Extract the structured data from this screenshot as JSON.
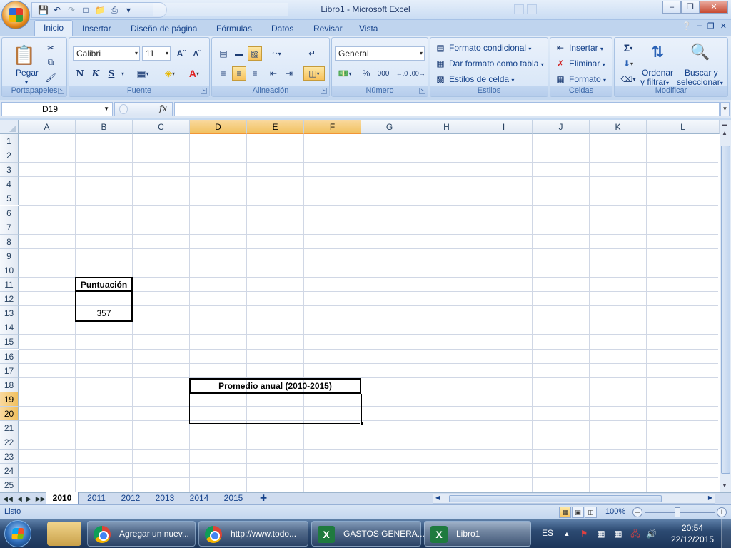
{
  "window": {
    "title": "Libro1 - Microsoft Excel"
  },
  "ribbon_tabs": [
    "Inicio",
    "Insertar",
    "Diseño de página",
    "Fórmulas",
    "Datos",
    "Revisar",
    "Vista"
  ],
  "ribbon": {
    "clipboard": {
      "paste": "Pegar",
      "label": "Portapapeles"
    },
    "font": {
      "name": "Calibri",
      "size": "11",
      "bold": "N",
      "italic": "K",
      "underline": "S",
      "label": "Fuente"
    },
    "alignment": {
      "label": "Alineación"
    },
    "number": {
      "format": "General",
      "percent": "%",
      "thousands": "000",
      "label": "Número"
    },
    "styles": {
      "conditional": "Formato condicional",
      "as_table": "Dar formato como tabla",
      "cell_styles": "Estilos de celda",
      "label": "Estilos"
    },
    "cells": {
      "insert": "Insertar",
      "delete": "Eliminar",
      "format": "Formato",
      "label": "Celdas"
    },
    "editing": {
      "sort_1": "Ordenar",
      "sort_2": "y filtrar",
      "find_1": "Buscar y",
      "find_2": "seleccionar",
      "label": "Modificar"
    }
  },
  "formula_bar": {
    "name_box": "D19",
    "fx": "fx",
    "formula": ""
  },
  "grid": {
    "columns": [
      "A",
      "B",
      "C",
      "D",
      "E",
      "F",
      "G",
      "H",
      "I",
      "J",
      "K",
      "L"
    ],
    "rows": [
      "1",
      "2",
      "3",
      "4",
      "5",
      "6",
      "7",
      "8",
      "9",
      "10",
      "11",
      "12",
      "13",
      "14",
      "15",
      "16",
      "17",
      "18",
      "19",
      "20",
      "21",
      "22",
      "23",
      "24",
      "25"
    ],
    "selected_columns": [
      "D",
      "E",
      "F"
    ],
    "selected_rows": [
      "19",
      "20"
    ],
    "cells": {
      "B11": "Puntuación",
      "B13": "357",
      "D18": "Promedio anual (2010-2015)"
    }
  },
  "sheets": [
    "2010",
    "2011",
    "2012",
    "2013",
    "2014",
    "2015"
  ],
  "active_sheet": "2010",
  "status": {
    "text": "Listo",
    "zoom": "100%"
  },
  "taskbar": {
    "items": [
      {
        "label": "Agregar un nuev..."
      },
      {
        "label": "http://www.todo..."
      },
      {
        "label": "GASTOS GENERA..."
      },
      {
        "label": "Libro1"
      }
    ],
    "lang": "ES",
    "time": "20:54",
    "date": "22/12/2015"
  }
}
